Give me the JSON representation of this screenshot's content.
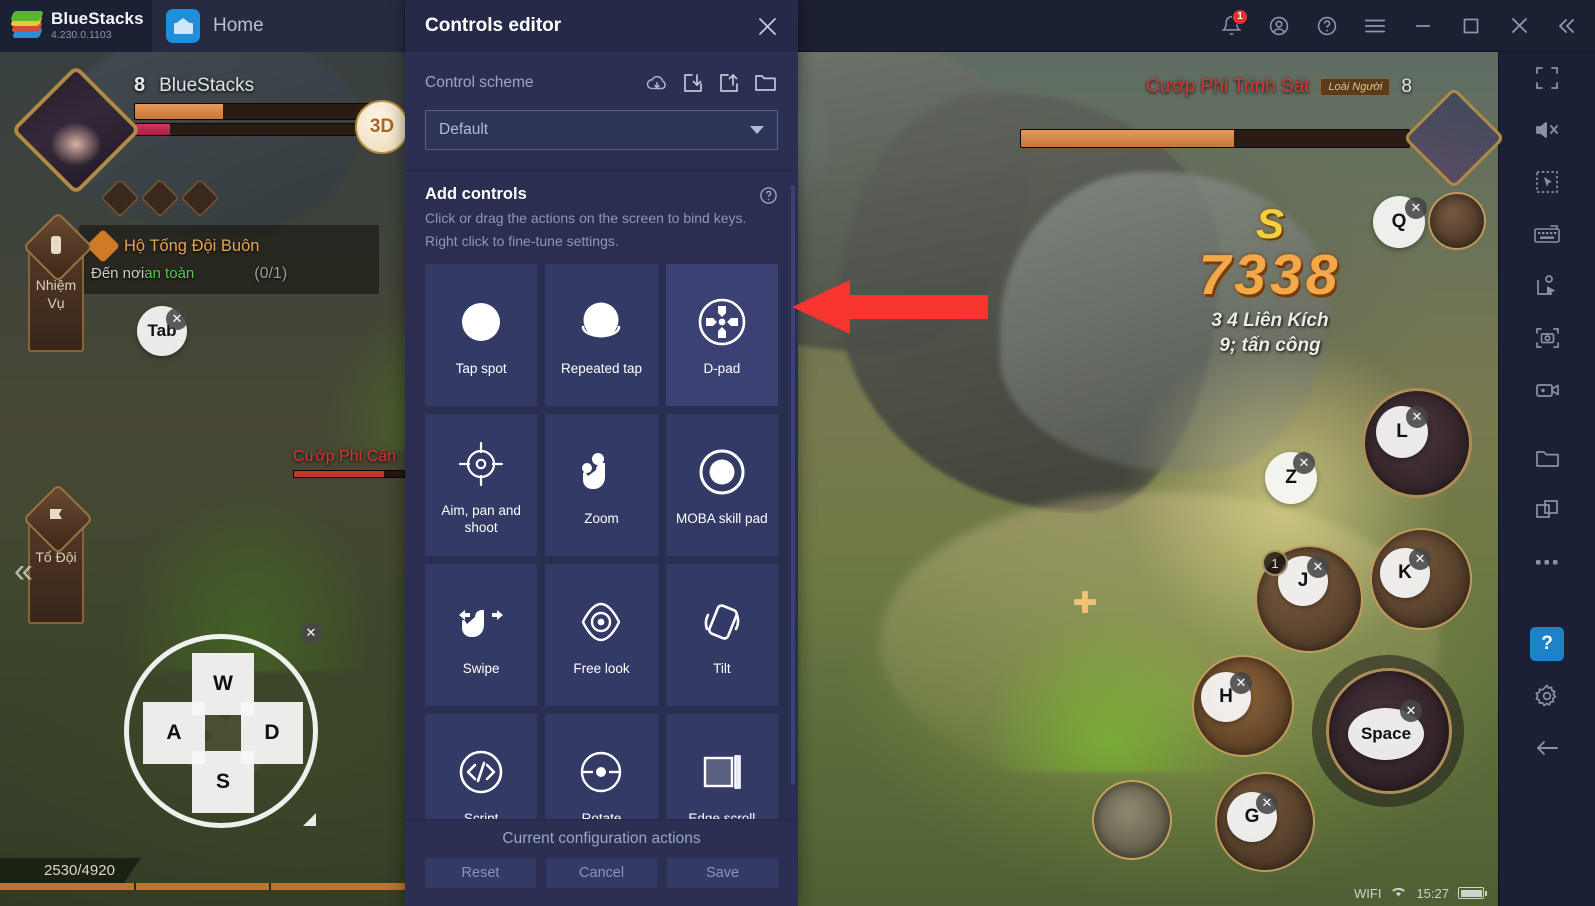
{
  "app": {
    "brand_name": "BlueStacks",
    "version": "4.230.0.1103",
    "tab_label": "Home",
    "tab_icon": "home-icon"
  },
  "titlebar_actions": [
    {
      "name": "notifications-icon",
      "label": "Notifications",
      "badge": "1"
    },
    {
      "name": "account-icon",
      "label": "Account"
    },
    {
      "name": "help-icon",
      "label": "Help"
    },
    {
      "name": "menu-icon",
      "label": "Menu"
    },
    {
      "name": "minimize-icon",
      "label": "Minimize"
    },
    {
      "name": "maximize-icon",
      "label": "Maximize"
    },
    {
      "name": "close-icon",
      "label": "Close"
    },
    {
      "name": "collapse-icon",
      "label": "Collapse sidebar"
    }
  ],
  "sidebar": {
    "items": [
      {
        "name": "fullscreen-icon",
        "label": "Full screen"
      },
      {
        "name": "mute-icon",
        "label": "Mute"
      },
      {
        "name": "cursor-select-icon",
        "label": "Mouse control"
      },
      {
        "name": "keyboard-icon",
        "label": "Game controls"
      },
      {
        "name": "macro-icon",
        "label": "Macro recorder"
      },
      {
        "name": "screenshot-icon",
        "label": "Screenshot"
      },
      {
        "name": "record-icon",
        "label": "Record screen"
      },
      {
        "name": "media-folder-icon",
        "label": "Media manager"
      },
      {
        "name": "multi-instance-icon",
        "label": "Multi-instance manager"
      },
      {
        "name": "more-icon",
        "label": "More"
      },
      {
        "name": "help-square-icon",
        "label": "?",
        "active": true
      },
      {
        "name": "settings-gear-icon",
        "label": "Settings"
      },
      {
        "name": "back-arrow-icon",
        "label": "Back"
      }
    ]
  },
  "panel": {
    "title": "Controls editor",
    "close_icon": "close-icon",
    "scheme": {
      "label": "Control scheme",
      "selected": "Default",
      "dropdown_icon": "chevron-down-icon",
      "actions": [
        {
          "name": "cloud-sync-icon",
          "label": "Sync to cloud"
        },
        {
          "name": "import-icon",
          "label": "Import scheme"
        },
        {
          "name": "export-icon",
          "label": "Export scheme"
        },
        {
          "name": "folder-icon",
          "label": "Open folder"
        }
      ]
    },
    "add_controls": {
      "title": "Add controls",
      "help_icon": "question-circle-icon",
      "description_line1": "Click or drag the actions on the screen to bind keys.",
      "description_line2": "Right click to fine-tune settings.",
      "tiles": [
        {
          "label": "Tap spot",
          "icon": "tap-spot-icon",
          "highlighted": false
        },
        {
          "label": "Repeated tap",
          "icon": "repeated-tap-icon",
          "highlighted": false
        },
        {
          "label": "D-pad",
          "icon": "dpad-icon",
          "highlighted": true
        },
        {
          "label": "Aim, pan and shoot",
          "icon": "crosshair-icon",
          "highlighted": false
        },
        {
          "label": "Zoom",
          "icon": "pinch-zoom-icon",
          "highlighted": false
        },
        {
          "label": "MOBA skill pad",
          "icon": "moba-skill-pad-icon",
          "highlighted": false
        },
        {
          "label": "Swipe",
          "icon": "swipe-icon",
          "highlighted": false
        },
        {
          "label": "Free look",
          "icon": "free-look-eye-icon",
          "highlighted": false
        },
        {
          "label": "Tilt",
          "icon": "tilt-icon",
          "highlighted": false
        },
        {
          "label": "Script",
          "icon": "script-code-icon",
          "highlighted": false
        },
        {
          "label": "Rotate",
          "icon": "rotate-icon",
          "highlighted": false
        },
        {
          "label": "Edge scroll",
          "icon": "edge-scroll-icon",
          "highlighted": false
        }
      ]
    },
    "footer": {
      "title": "Current configuration actions",
      "buttons": [
        {
          "label": "Reset",
          "name": "reset-button"
        },
        {
          "label": "Cancel",
          "name": "cancel-button"
        },
        {
          "label": "Save",
          "name": "save-button"
        }
      ]
    }
  },
  "annotation": {
    "arrow_color": "#f8342e",
    "points_to": "D-pad"
  },
  "game": {
    "player": {
      "level": "8",
      "name": "BlueStacks",
      "hp_percent": 35,
      "mp_percent": 14
    },
    "quest": {
      "title": "Hộ Tống Đội Buôn",
      "subtitle_prefix": "Đến nơi ",
      "subtitle_highlight": "an toàn",
      "counter": "(0/1)"
    },
    "side_tabs": [
      {
        "label": "Nhiệm Vụ",
        "name": "quest-tab"
      },
      {
        "label": "Tổ Đội",
        "name": "party-tab"
      }
    ],
    "enemy": {
      "name": "Cướp Phỉ Trinh Sát",
      "tag": "Loài Người",
      "level": "8",
      "hp_percent": 55
    },
    "enemy_secondary": {
      "name": "Cướp Phỉ Cấn",
      "hp_percent": 82
    },
    "damage": {
      "grade": "S",
      "value": "7338",
      "line1": "3 4 Liên Kích",
      "line2": "9; tấn công"
    },
    "exp": {
      "value": "2530/4920"
    },
    "status_bar": {
      "wifi_label": "WIFI",
      "time": "15:27",
      "wifi_icon": "wifi-icon",
      "battery_icon": "battery-icon"
    },
    "view_button": {
      "label": "3D",
      "name": "view-3d-button"
    },
    "bound_keys": [
      {
        "key": "Tab",
        "name": "keybind-tab"
      },
      {
        "key": "Q",
        "name": "keybind-q"
      },
      {
        "key": "L",
        "name": "keybind-l"
      },
      {
        "key": "Z",
        "name": "keybind-z"
      },
      {
        "key": "J",
        "name": "keybind-j"
      },
      {
        "key": "K",
        "name": "keybind-k"
      },
      {
        "key": "H",
        "name": "keybind-h"
      },
      {
        "key": "G",
        "name": "keybind-g"
      },
      {
        "key": "Space",
        "name": "keybind-space"
      }
    ],
    "dpad": {
      "up": "W",
      "left": "A",
      "down": "S",
      "right": "D",
      "charge_badge": "1"
    }
  }
}
